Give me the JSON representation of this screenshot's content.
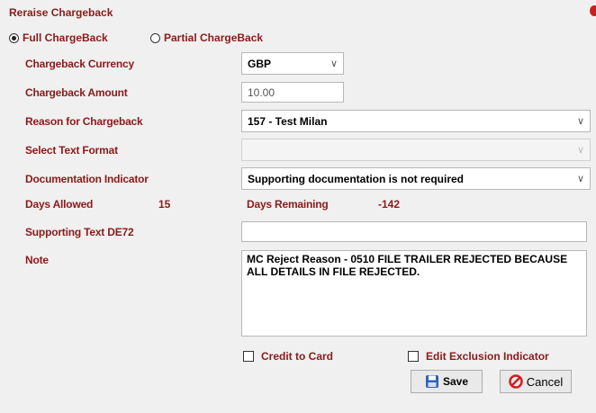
{
  "window": {
    "title": "Reraise Chargeback"
  },
  "chargeback_type": {
    "options": [
      {
        "label": "Full ChargeBack",
        "selected": true
      },
      {
        "label": "Partial ChargeBack",
        "selected": false
      }
    ]
  },
  "form": {
    "currency": {
      "label": "Chargeback Currency",
      "value": "GBP"
    },
    "amount": {
      "label": "Chargeback Amount",
      "value": "10.00"
    },
    "reason": {
      "label": "Reason for Chargeback",
      "value": "157 - Test Milan"
    },
    "text_format": {
      "label": "Select Text Format",
      "value": ""
    },
    "documentation": {
      "label": "Documentation Indicator",
      "value": "Supporting documentation is not required"
    },
    "days_allowed": {
      "label": "Days Allowed",
      "value": "15"
    },
    "days_remaining": {
      "label": "Days Remaining",
      "value": "-142"
    },
    "supporting_text": {
      "label": "Supporting Text DE72",
      "value": ""
    },
    "note": {
      "label": "Note",
      "value": "MC Reject Reason - 0510 FILE TRAILER REJECTED BECAUSE ALL DETAILS IN FILE REJECTED."
    }
  },
  "options": {
    "credit_to_card": {
      "label": "Credit to Card",
      "checked": false
    },
    "edit_exclusion": {
      "label": "Edit Exclusion Indicator",
      "checked": false
    }
  },
  "buttons": {
    "save": "Save",
    "cancel": "Cancel"
  },
  "icons": {
    "save": "save-disk-icon",
    "cancel": "cancel-circle-icon",
    "close": "close-icon"
  },
  "colors": {
    "label": "#8b1a1a",
    "background": "#f0f0f0"
  }
}
